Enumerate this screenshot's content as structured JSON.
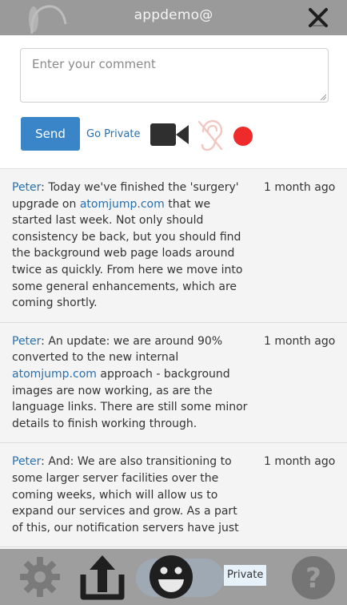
{
  "header": {
    "title": "appdemo@"
  },
  "compose": {
    "placeholder": "Enter your comment",
    "send_label": "Send",
    "private_link": "Go Private"
  },
  "messages": [
    {
      "author": "Peter",
      "sep": ":",
      "pre": " Today we've finished the 'surgery' upgrade on ",
      "link": "atomjump.com",
      "post": " that we started last week. Not only should consistency be back, but you should find the background web page loads around twice as quickly. From here we move into some general enhancements, which are coming shortly.",
      "time": "1 month ago"
    },
    {
      "author": "Peter",
      "sep": ":",
      "pre": " An update: we are around 90% converted to the new internal ",
      "link": "atomjump.com",
      "post": " approach - background images are now working, as are the language links. There are still some minor details to finish working through.",
      "time": "1 month ago"
    },
    {
      "author": "Peter",
      "sep": ":",
      "pre": " And: We are also transitioning to some larger server facilities over the coming weeks, which will allow us to expand our services and grow. As a part of this, our notification servers have just",
      "link": "",
      "post": "",
      "time": "1 month ago"
    }
  ],
  "footer": {
    "private_label": "Private"
  },
  "colors": {
    "header_bg": "#9a9a9a",
    "send_button": "#3a85c7",
    "link": "#2a6fad",
    "record": "#ee2a2a"
  }
}
